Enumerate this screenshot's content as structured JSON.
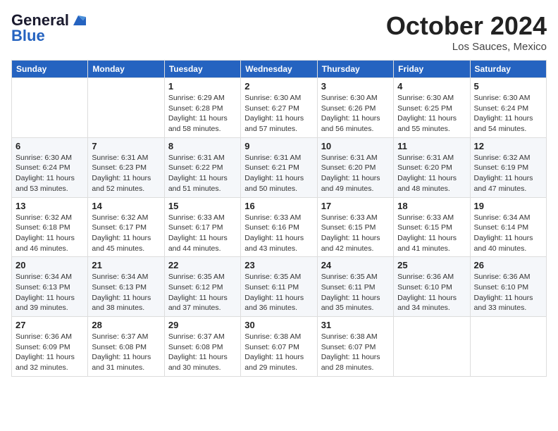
{
  "logo": {
    "general": "General",
    "blue": "Blue"
  },
  "header": {
    "month": "October 2024",
    "location": "Los Sauces, Mexico"
  },
  "weekdays": [
    "Sunday",
    "Monday",
    "Tuesday",
    "Wednesday",
    "Thursday",
    "Friday",
    "Saturday"
  ],
  "weeks": [
    [
      {
        "day": "",
        "detail": ""
      },
      {
        "day": "",
        "detail": ""
      },
      {
        "day": "1",
        "detail": "Sunrise: 6:29 AM\nSunset: 6:28 PM\nDaylight: 11 hours and 58 minutes."
      },
      {
        "day": "2",
        "detail": "Sunrise: 6:30 AM\nSunset: 6:27 PM\nDaylight: 11 hours and 57 minutes."
      },
      {
        "day": "3",
        "detail": "Sunrise: 6:30 AM\nSunset: 6:26 PM\nDaylight: 11 hours and 56 minutes."
      },
      {
        "day": "4",
        "detail": "Sunrise: 6:30 AM\nSunset: 6:25 PM\nDaylight: 11 hours and 55 minutes."
      },
      {
        "day": "5",
        "detail": "Sunrise: 6:30 AM\nSunset: 6:24 PM\nDaylight: 11 hours and 54 minutes."
      }
    ],
    [
      {
        "day": "6",
        "detail": "Sunrise: 6:30 AM\nSunset: 6:24 PM\nDaylight: 11 hours and 53 minutes."
      },
      {
        "day": "7",
        "detail": "Sunrise: 6:31 AM\nSunset: 6:23 PM\nDaylight: 11 hours and 52 minutes."
      },
      {
        "day": "8",
        "detail": "Sunrise: 6:31 AM\nSunset: 6:22 PM\nDaylight: 11 hours and 51 minutes."
      },
      {
        "day": "9",
        "detail": "Sunrise: 6:31 AM\nSunset: 6:21 PM\nDaylight: 11 hours and 50 minutes."
      },
      {
        "day": "10",
        "detail": "Sunrise: 6:31 AM\nSunset: 6:20 PM\nDaylight: 11 hours and 49 minutes."
      },
      {
        "day": "11",
        "detail": "Sunrise: 6:31 AM\nSunset: 6:20 PM\nDaylight: 11 hours and 48 minutes."
      },
      {
        "day": "12",
        "detail": "Sunrise: 6:32 AM\nSunset: 6:19 PM\nDaylight: 11 hours and 47 minutes."
      }
    ],
    [
      {
        "day": "13",
        "detail": "Sunrise: 6:32 AM\nSunset: 6:18 PM\nDaylight: 11 hours and 46 minutes."
      },
      {
        "day": "14",
        "detail": "Sunrise: 6:32 AM\nSunset: 6:17 PM\nDaylight: 11 hours and 45 minutes."
      },
      {
        "day": "15",
        "detail": "Sunrise: 6:33 AM\nSunset: 6:17 PM\nDaylight: 11 hours and 44 minutes."
      },
      {
        "day": "16",
        "detail": "Sunrise: 6:33 AM\nSunset: 6:16 PM\nDaylight: 11 hours and 43 minutes."
      },
      {
        "day": "17",
        "detail": "Sunrise: 6:33 AM\nSunset: 6:15 PM\nDaylight: 11 hours and 42 minutes."
      },
      {
        "day": "18",
        "detail": "Sunrise: 6:33 AM\nSunset: 6:15 PM\nDaylight: 11 hours and 41 minutes."
      },
      {
        "day": "19",
        "detail": "Sunrise: 6:34 AM\nSunset: 6:14 PM\nDaylight: 11 hours and 40 minutes."
      }
    ],
    [
      {
        "day": "20",
        "detail": "Sunrise: 6:34 AM\nSunset: 6:13 PM\nDaylight: 11 hours and 39 minutes."
      },
      {
        "day": "21",
        "detail": "Sunrise: 6:34 AM\nSunset: 6:13 PM\nDaylight: 11 hours and 38 minutes."
      },
      {
        "day": "22",
        "detail": "Sunrise: 6:35 AM\nSunset: 6:12 PM\nDaylight: 11 hours and 37 minutes."
      },
      {
        "day": "23",
        "detail": "Sunrise: 6:35 AM\nSunset: 6:11 PM\nDaylight: 11 hours and 36 minutes."
      },
      {
        "day": "24",
        "detail": "Sunrise: 6:35 AM\nSunset: 6:11 PM\nDaylight: 11 hours and 35 minutes."
      },
      {
        "day": "25",
        "detail": "Sunrise: 6:36 AM\nSunset: 6:10 PM\nDaylight: 11 hours and 34 minutes."
      },
      {
        "day": "26",
        "detail": "Sunrise: 6:36 AM\nSunset: 6:10 PM\nDaylight: 11 hours and 33 minutes."
      }
    ],
    [
      {
        "day": "27",
        "detail": "Sunrise: 6:36 AM\nSunset: 6:09 PM\nDaylight: 11 hours and 32 minutes."
      },
      {
        "day": "28",
        "detail": "Sunrise: 6:37 AM\nSunset: 6:08 PM\nDaylight: 11 hours and 31 minutes."
      },
      {
        "day": "29",
        "detail": "Sunrise: 6:37 AM\nSunset: 6:08 PM\nDaylight: 11 hours and 30 minutes."
      },
      {
        "day": "30",
        "detail": "Sunrise: 6:38 AM\nSunset: 6:07 PM\nDaylight: 11 hours and 29 minutes."
      },
      {
        "day": "31",
        "detail": "Sunrise: 6:38 AM\nSunset: 6:07 PM\nDaylight: 11 hours and 28 minutes."
      },
      {
        "day": "",
        "detail": ""
      },
      {
        "day": "",
        "detail": ""
      }
    ]
  ]
}
